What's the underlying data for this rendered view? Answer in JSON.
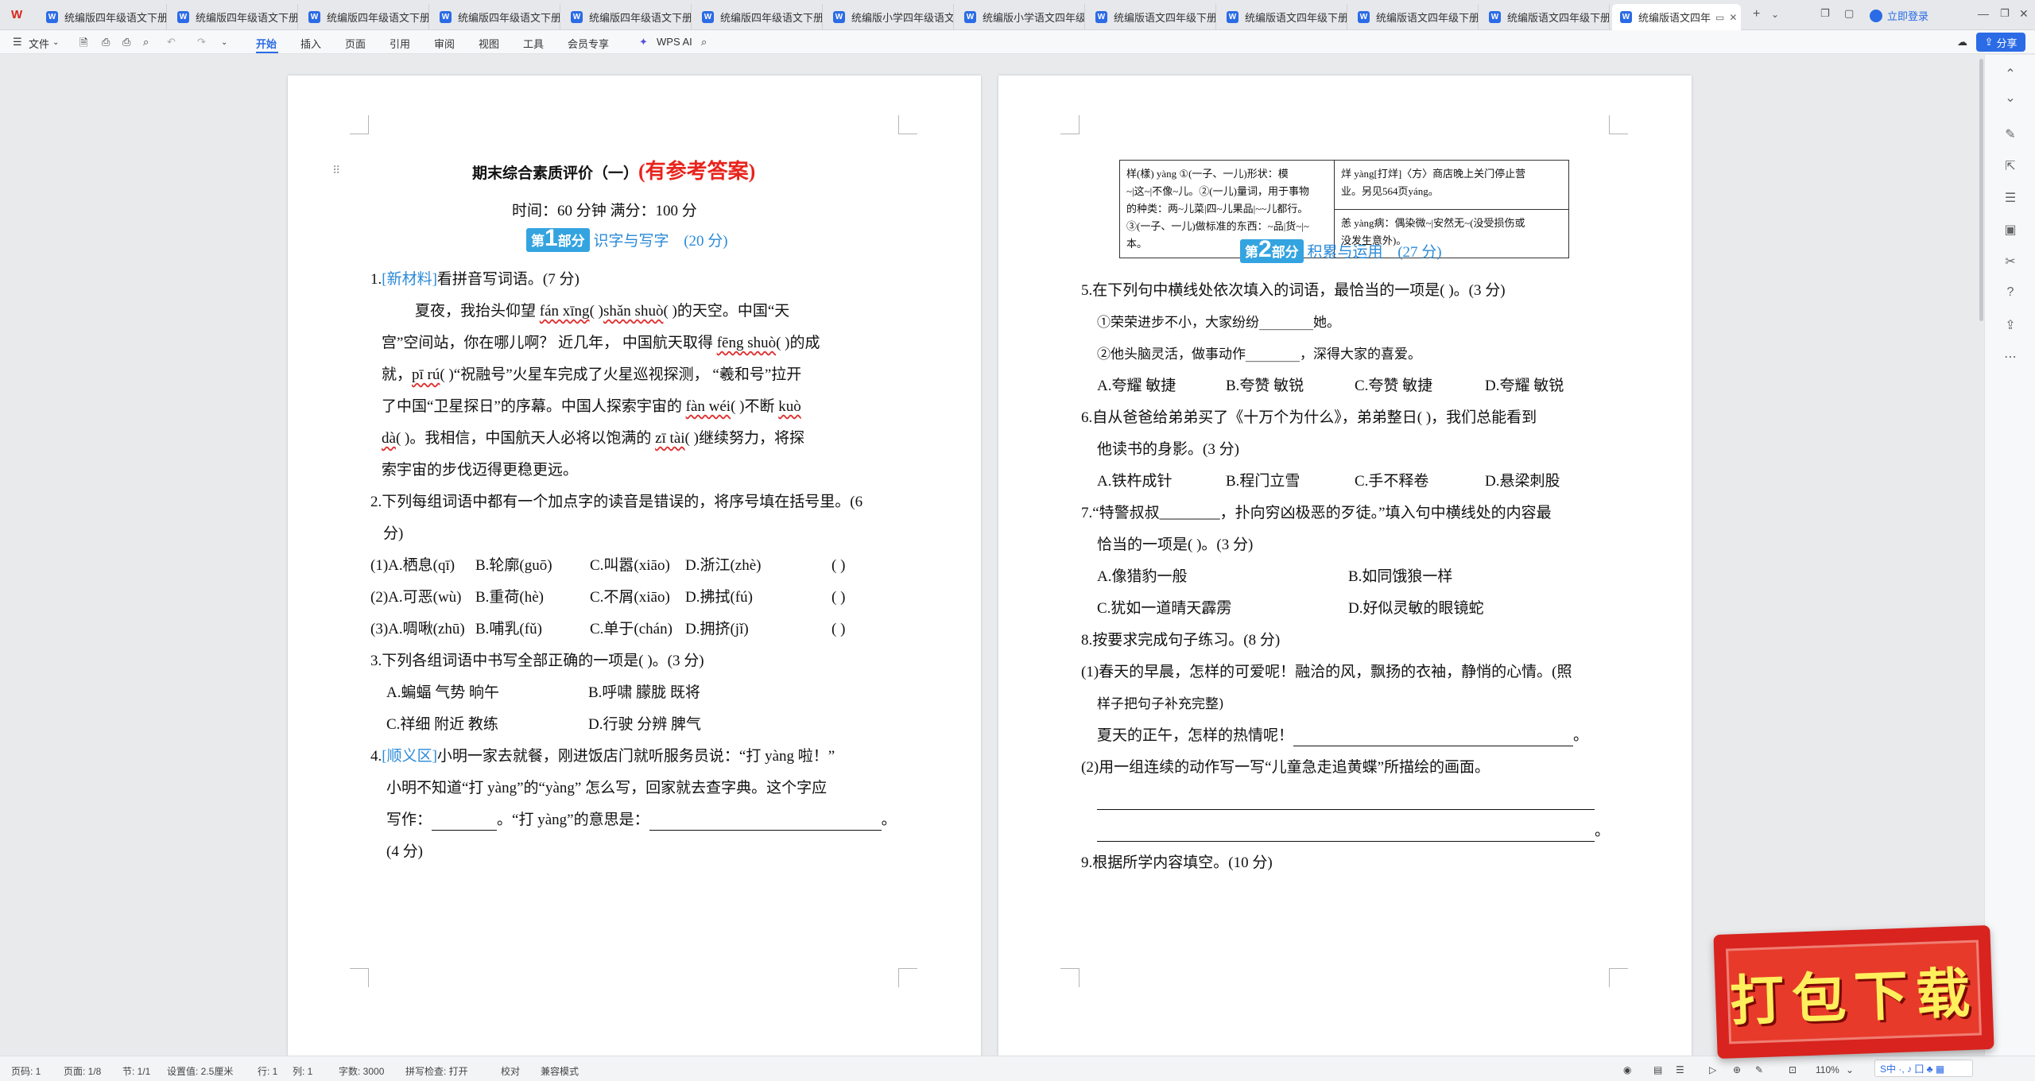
{
  "tabs": [
    {
      "title": "统编版四年级语文下册"
    },
    {
      "title": "统编版四年级语文下册"
    },
    {
      "title": "统编版四年级语文下册"
    },
    {
      "title": "统编版四年级语文下册"
    },
    {
      "title": "统编版四年级语文下册"
    },
    {
      "title": "统编版四年级语文下册"
    },
    {
      "title": "统编版小学四年级语文"
    },
    {
      "title": "统编版小学语文四年级"
    },
    {
      "title": "统编版语文四年级下册"
    },
    {
      "title": "统编版语文四年级下册"
    },
    {
      "title": "统编版语文四年级下册"
    },
    {
      "title": "统编版语文四年级下册"
    },
    {
      "title": "统编版语文四年"
    }
  ],
  "tabbar": {
    "add": "+",
    "dropdown": "⌄",
    "login": "立即登录",
    "w_badge": "W"
  },
  "ribbon": {
    "file": "文件",
    "items": [
      "开始",
      "插入",
      "页面",
      "引用",
      "审阅",
      "视图",
      "工具",
      "会员专享"
    ],
    "wps_ai": "WPS AI",
    "share": "分享"
  },
  "page1": {
    "title": "期末综合素质评价（一）",
    "title_red": "(有参考答案)",
    "subtitle": "时间：60 分钟    满分：100 分",
    "part": {
      "pre": "第",
      "num": "1",
      "post": "部分",
      "name": "识字与写字",
      "score": "(20 分)"
    },
    "q1_label": "1.",
    "q1_tag": "[新材料]",
    "q1_text": "看拼音写词语。(7 分)",
    "p1_l1a": "夏夜，我抬头仰望",
    "p1_py1": "fán xīng",
    "p1_l1b": "(        )",
    "p1_py2": "shǎn shuò",
    "p1_l1c": "(        )的天空。中国“天",
    "p1_l2a": "宫”空间站，你在哪儿啊？  近几年，  中国航天取得",
    "p1_py3": "fēng shuò",
    "p1_l2b": "(        )的成",
    "p1_l3a": "就，",
    "p1_py4": "pī rú",
    "p1_l3b": "(        )“祝融号”火星车完成了火星巡视探测，  “羲和号”拉开",
    "p1_l4a": "了中国“卫星探日”的序幕。中国人探索宇宙的",
    "p1_py5": "fàn wéi",
    "p1_l4b": "(        )不断",
    "p1_py6": "kuò",
    "p1_py7": "dà",
    "p1_l5a": "(        )。我相信，中国航天人必将以饱满的",
    "p1_py8": "zī tài",
    "p1_l5b": "(        )继续努力，将探",
    "p1_l6": "索宇宙的步伐迈得更稳更远。",
    "q2_l1": "2.下列每组词语中都有一个加点字的读音是错误的，将序号填在括号里。(6",
    "q2_l2": "分)",
    "q2_rows": [
      {
        "a": "(1)A.栖息(qī)",
        "b": "B.轮廓(guō)",
        "c": "C.叫嚣(xiāo)",
        "d": "D.浙江(zhè)",
        "ans": "(        )"
      },
      {
        "a": "(2)A.可恶(wù)",
        "b": "B.重荷(hè)",
        "c": "C.不屑(xiāo)",
        "d": "D.拂拭(fú)",
        "ans": "(        )"
      },
      {
        "a": "(3)A.啁啾(zhū)",
        "b": "B.哺乳(fǔ)",
        "c": "C.单于(chán)",
        "d": "D.拥挤(jǐ)",
        "ans": "(        )"
      }
    ],
    "q3_l1": "3.下列各组词语中书写全部正确的一项是(        )。(3 分)",
    "q3_opts": [
      {
        "left": "A.蝙蝠    气势    晌午",
        "right": "B.呼啸    朦胧    既将"
      },
      {
        "left": "C.祥细    附近    教练",
        "right": "D.行驶    分辨    脾气"
      }
    ],
    "q4_label": "4.",
    "q4_tag": "[顺义区]",
    "q4_l1": "小明一家去就餐，刚进饭店门就听服务员说：“打  yàng  啦！”",
    "q4_l2": "小明不知道“打  yàng”的“yàng”  怎么写，回家就去查字典。这个字应",
    "q4_l3a": "写作：",
    "q4_l3b": "。“打 yàng”的意思是：",
    "q4_l3c": "。",
    "q4_l4": "(4 分)"
  },
  "page2": {
    "dict_tl1": "样(樣) yàng  ①(一子、一儿)形状：模",
    "dict_tl2": "~|这~|不像~儿。②(一儿)量词，用于事物",
    "dict_tl3": "的种类：两~儿菜|四~儿果品|~~儿都行。",
    "dict_tl4": "③(一子、一儿)做标准的东西：~品|货~|~本。",
    "dict_tr1": "烊 yàng[打烊]〈方〉商店晚上关门停止营",
    "dict_tr2": "业。另见564页yáng。",
    "dict_br1": "恙 yàng病：偶染微~|安然无~(没受损伤或",
    "dict_br2": "没发生意外)。",
    "part": {
      "pre": "第",
      "num": "2",
      "post": "部分",
      "name": "积累与运用",
      "score": "(27 分)"
    },
    "q5": "5.在下列句中横线处依次填入的词语，最恰当的一项是(        )。(3 分)",
    "q5_s1": "①荣荣进步不小，大家纷纷________她。",
    "q5_s2": "②他头脑灵活，做事动作________，深得大家的喜爱。",
    "q5_opts": [
      "A.夸耀    敏捷",
      "B.夸赞    敏锐",
      "C.夸赞    敏捷",
      "D.夸耀    敏锐"
    ],
    "q6_l1": "6.自从爸爸给弟弟买了《十万个为什么》，弟弟整日(        )，我们总能看到",
    "q6_l2": "他读书的身影。(3 分)",
    "q6_opts": [
      "A.铁杵成针",
      "B.程门立雪",
      "C.手不释卷",
      "D.悬梁刺股"
    ],
    "q7_l1": "7.“特警叔叔________，扑向穷凶极恶的歹徒。”填入句中横线处的内容最",
    "q7_l2": "恰当的一项是(        )。(3 分)",
    "q7_opts": [
      {
        "left": "A.像猎豹一般",
        "right": "B.如同饿狼一样"
      },
      {
        "left": "C.犹如一道晴天霹雳",
        "right": "D.好似灵敏的眼镜蛇"
      }
    ],
    "q8": "8.按要求完成句子练习。(8 分)",
    "q8_1_l1": "(1)春天的早晨，怎样的可爱呢！融洽的风，飘扬的衣袖，静悄的心情。(照",
    "q8_1_l2": "样子把句子补充完整)",
    "q8_1_l3": "夏天的正午，怎样的热情呢！",
    "q8_1_end": "。",
    "q8_2": "(2)用一组连续的动作写一写“儿童急走追黄蝶”所描绘的画面。",
    "q8_2_end": "。",
    "q9": "9.根据所学内容填空。(10 分)"
  },
  "status": {
    "page": "页码: 1",
    "pages": "页面: 1/8",
    "section": "节: 1/1",
    "setting": "设置值: 2.5厘米",
    "row": "行: 1",
    "col": "列: 1",
    "words": "字数: 3000",
    "spell": "拼写检查: 打开",
    "proof": "校对",
    "compat": "兼容模式",
    "zoom": "110%"
  },
  "ime": {
    "label": "S中 ·, ♪ 囗 ♣ ▦"
  },
  "stamp": {
    "text": "打包下载"
  }
}
